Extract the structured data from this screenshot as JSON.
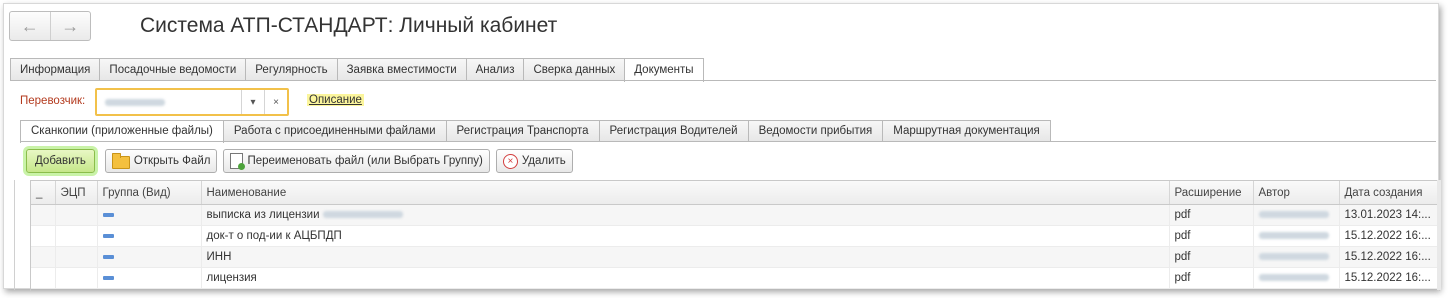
{
  "nav": {
    "back_glyph": "←",
    "forward_glyph": "→"
  },
  "window": {
    "title": "Система АТП-СТАНДАРТ: Личный кабинет"
  },
  "main_tabs": [
    {
      "label": "Информация"
    },
    {
      "label": "Посадочные ведомости"
    },
    {
      "label": "Регулярность"
    },
    {
      "label": "Заявка вместимости"
    },
    {
      "label": "Анализ"
    },
    {
      "label": "Сверка данных"
    },
    {
      "label": "Документы",
      "active": true
    }
  ],
  "carrier": {
    "label": "Перевозчик:",
    "dropdown_glyph": "▾",
    "clear_glyph": "×"
  },
  "description_link": "Описание",
  "sub_tabs": [
    {
      "label": "Сканкопии (приложенные файлы)",
      "active": true
    },
    {
      "label": "Работа с присоединенными файлами"
    },
    {
      "label": "Регистрация Транспорта"
    },
    {
      "label": "Регистрация Водителей"
    },
    {
      "label": "Ведомости прибытия"
    },
    {
      "label": "Маршрутная документация"
    }
  ],
  "toolbar": {
    "add": "Добавить",
    "open": "Открыть Файл",
    "rename": "Переименовать файл (или Выбрать Группу)",
    "delete": "Удалить",
    "delete_glyph": "×"
  },
  "table": {
    "columns": [
      "_",
      "ЭЦП",
      "Группа (Вид)",
      "Наименование",
      "Расширение",
      "Автор",
      "Дата создания"
    ],
    "rows": [
      {
        "name": "выписка из лицензии",
        "ext": "pdf",
        "date": "13.01.2023 14:..."
      },
      {
        "name": "док-т о под-ии к АЦБПДП",
        "ext": "pdf",
        "date": "15.12.2022 16:..."
      },
      {
        "name": "ИНН",
        "ext": "pdf",
        "date": "15.12.2022 16:..."
      },
      {
        "name": "лицензия",
        "ext": "pdf",
        "date": "15.12.2022 16:..."
      }
    ]
  },
  "colors": {
    "accent_yellow": "#f2c14a",
    "link_highlight": "#fbf59c",
    "primary_button": "#c6e78a",
    "row_marker": "#5a8fd6",
    "label_red": "#b33a1e"
  }
}
